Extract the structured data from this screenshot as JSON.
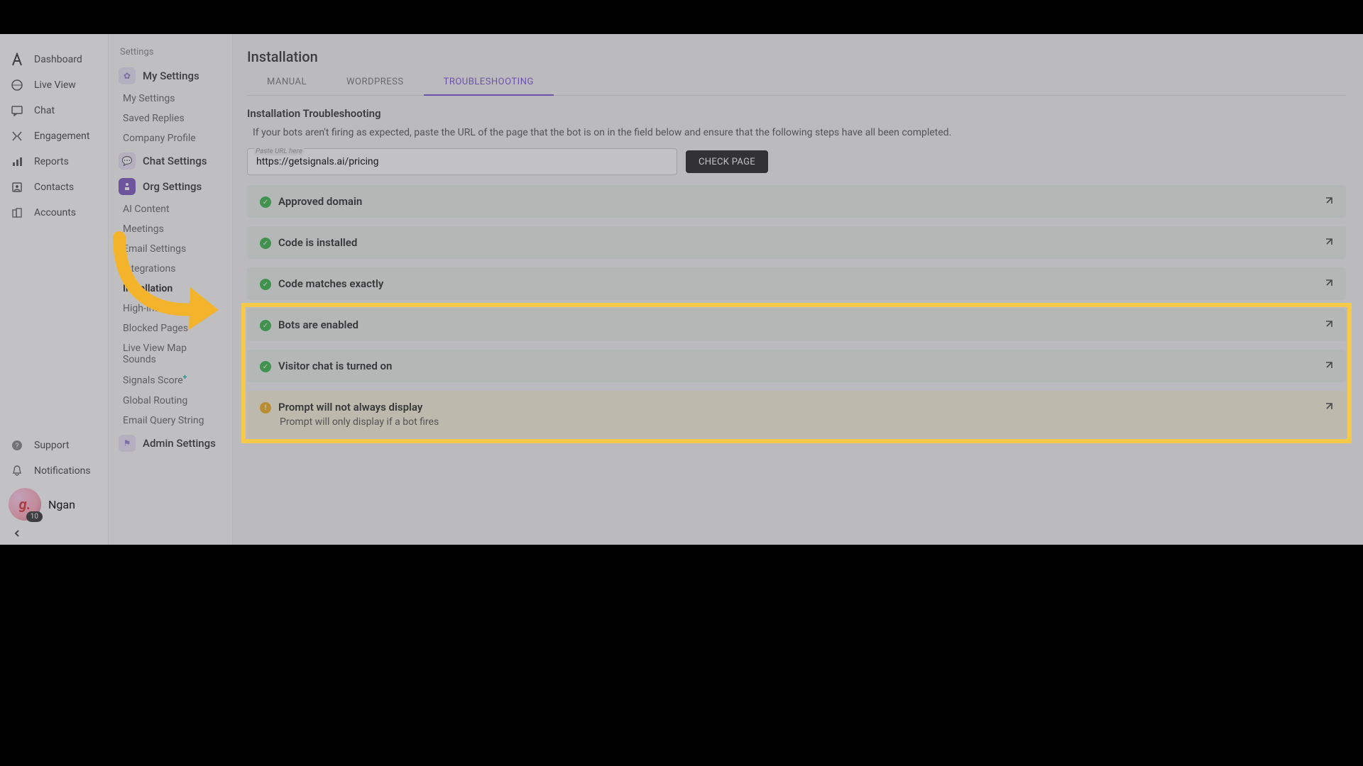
{
  "nav": {
    "items": [
      {
        "label": "Dashboard",
        "icon": "dashboard"
      },
      {
        "label": "Live View",
        "icon": "liveview"
      },
      {
        "label": "Chat",
        "icon": "chat"
      },
      {
        "label": "Engagement",
        "icon": "engagement"
      },
      {
        "label": "Reports",
        "icon": "reports"
      },
      {
        "label": "Contacts",
        "icon": "contacts"
      },
      {
        "label": "Accounts",
        "icon": "accounts"
      }
    ],
    "support": "Support",
    "notifications": "Notifications",
    "user_name": "Ngan",
    "avatar_initial": "g.",
    "notif_count": "10"
  },
  "settings": {
    "heading": "Settings",
    "my": {
      "label": "My Settings",
      "items": [
        "My Settings",
        "Saved Replies",
        "Company Profile"
      ]
    },
    "chat": {
      "label": "Chat Settings"
    },
    "org": {
      "label": "Org Settings",
      "items": [
        "AI Content",
        "Meetings",
        "Email Settings",
        "Integrations",
        "Installation",
        "High-Intent Pages",
        "Blocked Pages",
        "Live View Map Sounds",
        "Signals Score",
        "Global Routing",
        "Email Query String"
      ],
      "active_index": 4,
      "score_plus": "+"
    },
    "admin": {
      "label": "Admin Settings"
    }
  },
  "main": {
    "title": "Installation",
    "tabs": [
      "MANUAL",
      "WORDPRESS",
      "TROUBLESHOOTING"
    ],
    "active_tab": 2,
    "section_title": "Installation Troubleshooting",
    "help": "If your bots aren't firing as expected, paste the URL of the page that the bot is on in the field below and ensure that the following steps have all been completed.",
    "url_label": "Paste URL here",
    "url_value": "https://getsignals.ai/pricing",
    "check_btn": "CHECK PAGE",
    "checks": [
      {
        "status": "ok",
        "title": "Approved domain"
      },
      {
        "status": "ok",
        "title": "Code is installed"
      },
      {
        "status": "ok",
        "title": "Code matches exactly"
      },
      {
        "status": "ok",
        "title": "Bots are enabled"
      },
      {
        "status": "ok",
        "title": "Visitor chat is turned on"
      },
      {
        "status": "warn",
        "title": "Prompt will not always display",
        "subtitle": "Prompt will only display if a bot fires"
      }
    ]
  }
}
